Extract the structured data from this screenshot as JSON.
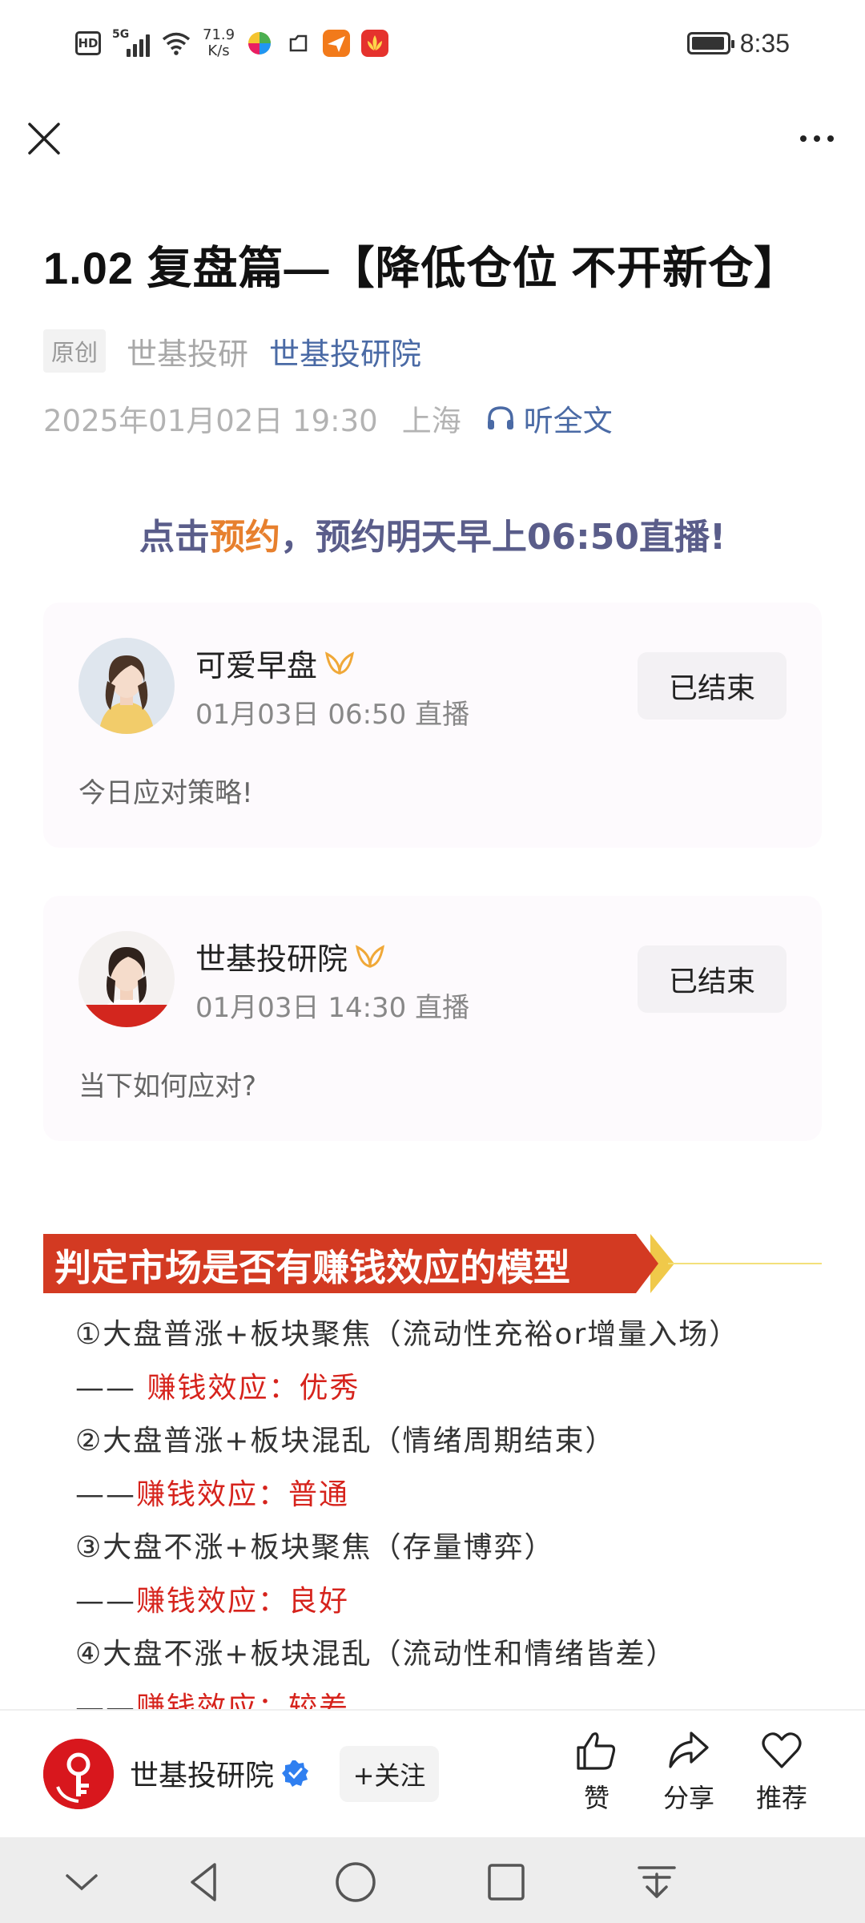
{
  "status_bar": {
    "network": "5G",
    "hd": "HD",
    "speed_value": "71.9",
    "speed_unit": "K/s",
    "time": "8:35",
    "battery_level": 0.95,
    "app_icons": [
      "pinwheel-icon",
      "cloud-icon",
      "paper-plane-icon",
      "lotus-icon"
    ]
  },
  "header": {
    "close_icon": "close-icon",
    "more_icon": "more-icon"
  },
  "article": {
    "title": "1.02 复盘篇—【降低仓位 不开新仓】",
    "original_tag": "原创",
    "author_plain": "世基投研",
    "author_link": "世基投研院",
    "date": "2025年01月02日 19:30",
    "location": "上海",
    "listen_label": "听全文"
  },
  "promo": {
    "prefix": "点击",
    "highlight": "预约",
    "suffix": "，预约明天早上06:50直播!"
  },
  "live_cards": [
    {
      "host": "可爱早盘",
      "time": "01月03日 06:50 直播",
      "status": "已结束",
      "description": "今日应对策略!"
    },
    {
      "host": "世基投研院",
      "time": "01月03日 14:30 直播",
      "status": "已结束",
      "description": "当下如何应对?"
    }
  ],
  "section": {
    "title": "判定市场是否有赚钱效应的模型"
  },
  "models": [
    {
      "condition": "①大盘普涨+板块聚焦（流动性充裕or增量入场）",
      "dash": "—— ",
      "result": "赚钱效应：优秀"
    },
    {
      "condition": "②大盘普涨+板块混乱（情绪周期结束）",
      "dash": "——",
      "result": "赚钱效应：普通"
    },
    {
      "condition": "③大盘不涨+板块聚焦（存量博弈）",
      "dash": "——",
      "result": "赚钱效应：良好"
    },
    {
      "condition": "④大盘不涨+板块混乱（流动性和情绪皆差）",
      "dash": "——",
      "result": "赚钱效应：较差"
    }
  ],
  "author_bar": {
    "name": "世基投研院",
    "follow_label": "+关注",
    "actions": [
      {
        "icon": "thumbs-up-icon",
        "label": "赞"
      },
      {
        "icon": "share-icon",
        "label": "分享"
      },
      {
        "icon": "heart-icon",
        "label": "推荐"
      }
    ]
  },
  "nav_bar": {
    "buttons": [
      "chevron-down-icon",
      "back-icon",
      "home-icon",
      "recents-icon",
      "pull-down-icon"
    ]
  },
  "colors": {
    "link": "#4a6aa5",
    "promo": "#5a5d8a",
    "promo_highlight": "#e7802e",
    "section_red": "#d33a22",
    "result_red": "#d6231c"
  }
}
